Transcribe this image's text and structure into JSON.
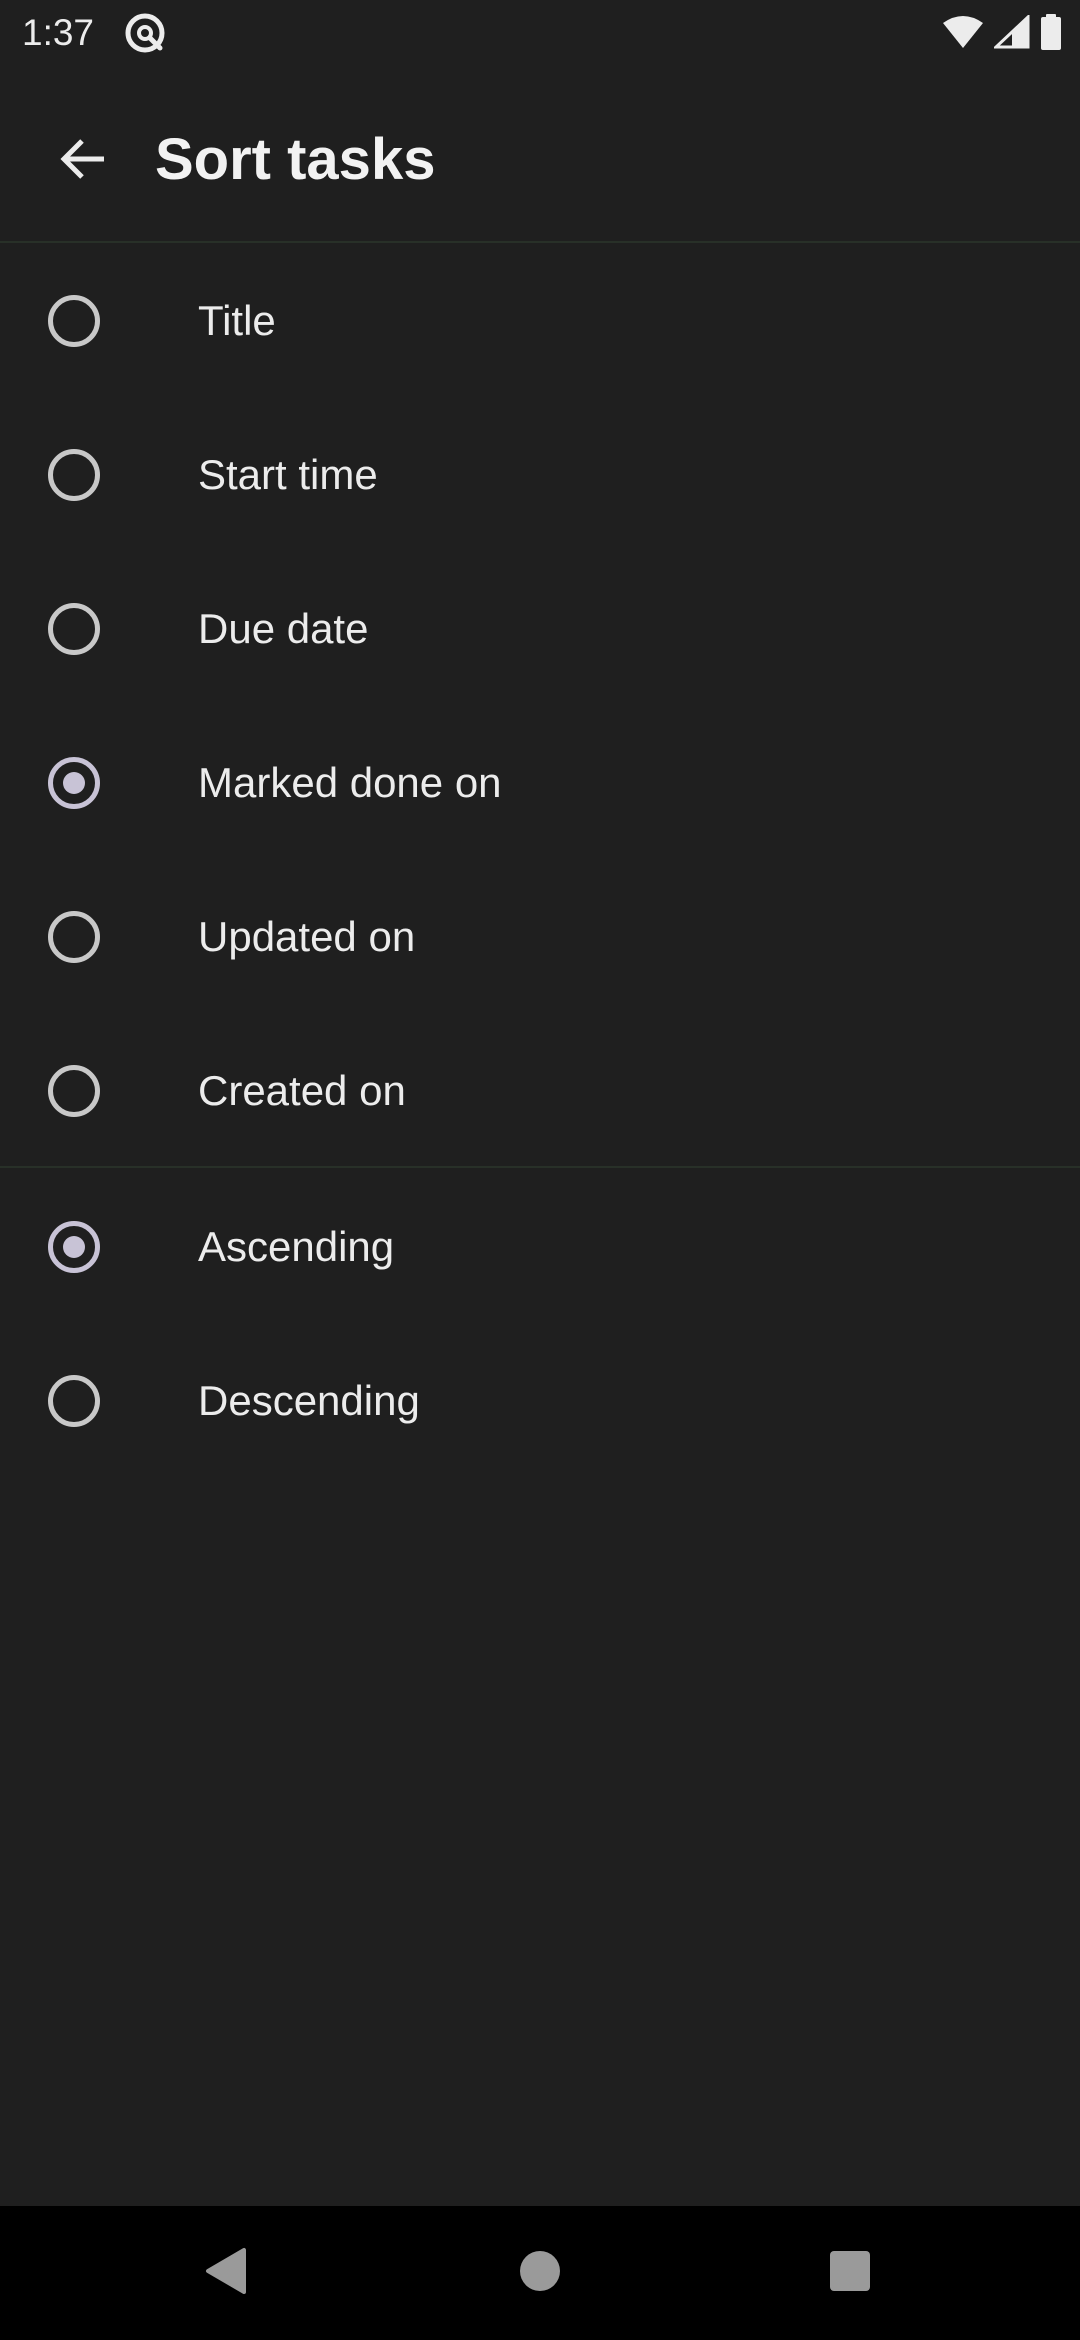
{
  "status_bar": {
    "time": "1:37",
    "app_icon": "at-sign-badge-icon",
    "icons": [
      "wifi-icon",
      "cell-signal-icon",
      "battery-icon"
    ]
  },
  "app_bar": {
    "back_icon": "arrow-back-icon",
    "title": "Sort tasks"
  },
  "sort_by": {
    "options": [
      {
        "label": "Title",
        "checked": false
      },
      {
        "label": "Start time",
        "checked": false
      },
      {
        "label": "Due date",
        "checked": false
      },
      {
        "label": "Marked done on",
        "checked": true
      },
      {
        "label": "Updated on",
        "checked": false
      },
      {
        "label": "Created on",
        "checked": false
      }
    ]
  },
  "sort_order": {
    "options": [
      {
        "label": "Ascending",
        "checked": true
      },
      {
        "label": "Descending",
        "checked": false
      }
    ]
  },
  "nav_bar": {
    "buttons": [
      "back-triangle-icon",
      "home-circle-icon",
      "recents-square-icon"
    ]
  },
  "colors": {
    "background": "#1f1f1f",
    "text": "#ececec",
    "radio_unchecked": "#c8c8c8",
    "radio_checked": "#c8c3d6",
    "nav_bar": "#000000"
  }
}
